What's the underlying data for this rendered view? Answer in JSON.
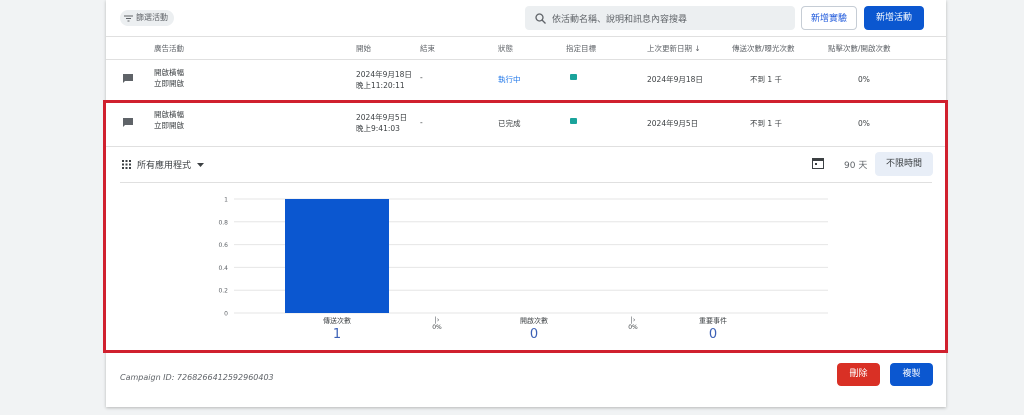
{
  "toolbar": {
    "filter_label": "篩選活動",
    "search_placeholder": "依活動名稱、說明和訊息內容搜尋",
    "new_experiment": "新增實驗",
    "new_campaign": "新增活動"
  },
  "columns": [
    "廣告活動",
    "開始",
    "結束",
    "狀態",
    "指定目標",
    "上次更新日期",
    "傳送次數/曝光次數",
    "點擊次數/開啟次數"
  ],
  "rows": [
    {
      "name": [
        "開啟橫幅",
        "立即開啟"
      ],
      "start": [
        "2024年9月18日",
        "晚上11:20:11"
      ],
      "end": "-",
      "status": "執行中",
      "updated": "2024年9月18日",
      "sends": "不到 1 千",
      "clicks": "0%"
    },
    {
      "name": [
        "開啟橫幅",
        "立即開啟"
      ],
      "start": [
        "2024年9月5日",
        "晚上9:41:03"
      ],
      "end": "-",
      "status": "已完成",
      "updated": "2024年9月5日",
      "sends": "不到 1 千",
      "clicks": "0%"
    }
  ],
  "expanded": {
    "app_selector": "所有應用程式",
    "range_days": "90 天",
    "range_unlimited": "不限時間"
  },
  "chart_data": {
    "type": "bar",
    "categories": [
      "傳送次數",
      "開啟次數",
      "重要事件"
    ],
    "values": [
      1,
      0,
      0
    ],
    "ylim": [
      0,
      1
    ],
    "yticks": [
      "0",
      "0.2",
      "0.4",
      "0.6",
      "0.8",
      "1"
    ],
    "rates": [
      "0%",
      "0%"
    ],
    "bar_color": "#0b57d0"
  },
  "metrics": [
    {
      "label": "傳送次數",
      "value": "1"
    },
    {
      "label": "開啟次數",
      "value": "0"
    },
    {
      "label": "重要事件",
      "value": "0"
    }
  ],
  "footer": {
    "campaign_id": "Campaign ID: 7268266412592960403",
    "delete": "刪除",
    "copy": "複製"
  },
  "colors": {
    "primary": "#0b57d0",
    "danger": "#d93025",
    "highlight": "#d0202e",
    "active": "#1a73e8"
  }
}
